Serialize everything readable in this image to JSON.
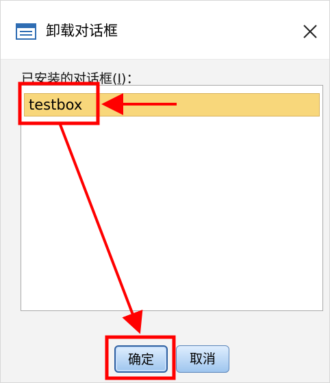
{
  "dialog": {
    "title": "卸载对话框",
    "close_symbol": "✕",
    "title_icon": "dialog-icon"
  },
  "list": {
    "label": "已安装的对话框",
    "mnemonic_open": "(",
    "mnemonic": "I",
    "mnemonic_close": ")",
    "colon": "：",
    "items": [
      "testbox"
    ],
    "selected_index": 0
  },
  "buttons": {
    "ok_label": "确定",
    "cancel_label": "取消"
  },
  "annotation": {
    "color": "#ff0000"
  }
}
